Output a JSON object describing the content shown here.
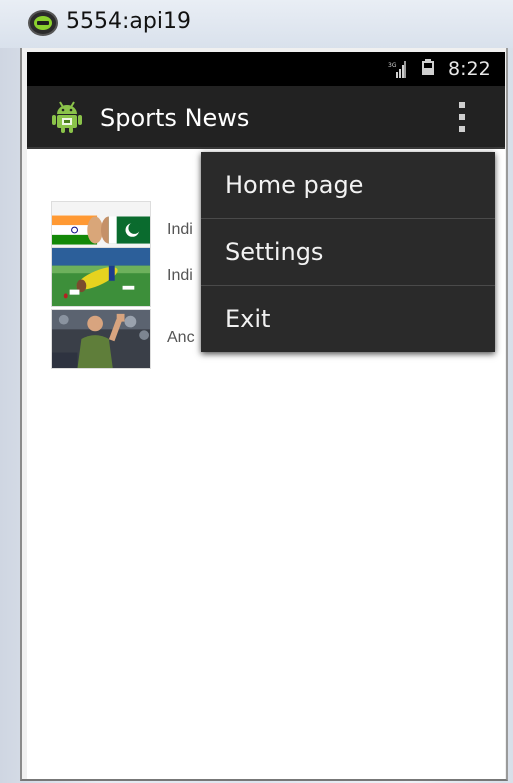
{
  "window": {
    "title": "5554:api19"
  },
  "status_bar": {
    "time": "8:22",
    "network": "3G"
  },
  "action_bar": {
    "app_title": "Sports News",
    "overflow_icon": "overflow-menu-icon"
  },
  "news_list": {
    "items": [
      {
        "text": "Indi",
        "thumbnail": "india-pakistan-flags-image"
      },
      {
        "text": "Indi",
        "thumbnail": "cricket-player-diving-image"
      },
      {
        "text": "Anc",
        "thumbnail": "tennis-player-celebrating-image"
      }
    ]
  },
  "overflow_menu": {
    "items": [
      {
        "label": "Home page"
      },
      {
        "label": "Settings"
      },
      {
        "label": "Exit"
      }
    ]
  },
  "colors": {
    "status_bar": "#000000",
    "action_bar": "#222222",
    "menu_background": "#2a2a2a",
    "app_icon_green": "#8bc34a"
  }
}
